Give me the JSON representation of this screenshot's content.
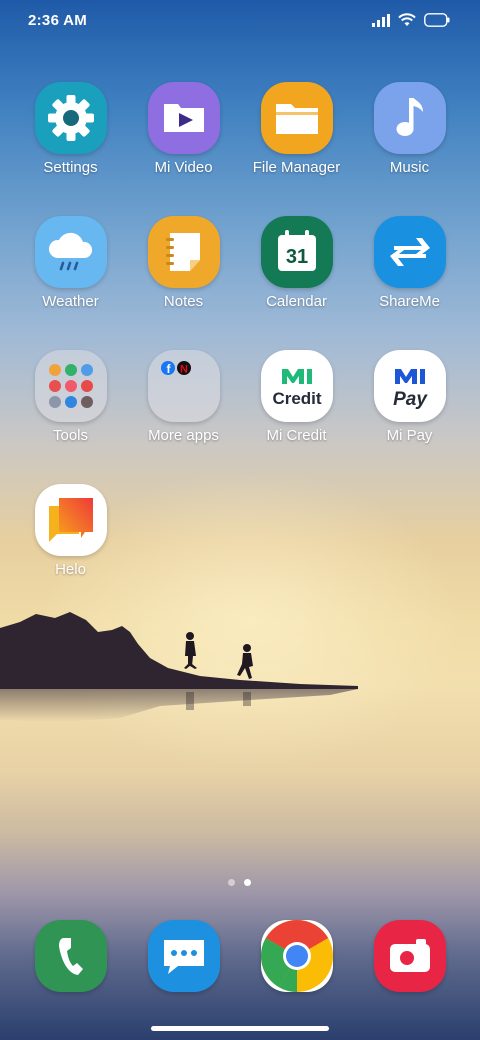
{
  "status_bar": {
    "time": "2:36 AM",
    "icons": [
      "signal-icon",
      "wifi-icon",
      "battery-icon"
    ]
  },
  "apps": [
    {
      "label": "Settings",
      "icon": "gear-icon"
    },
    {
      "label": "Mi Video",
      "icon": "mi-video-icon"
    },
    {
      "label": "File Manager",
      "icon": "folder-icon"
    },
    {
      "label": "Music",
      "icon": "music-note-icon"
    },
    {
      "label": "Weather",
      "icon": "rain-cloud-icon"
    },
    {
      "label": "Notes",
      "icon": "notes-icon"
    },
    {
      "label": "Calendar",
      "icon": "calendar-icon",
      "badge": "31"
    },
    {
      "label": "ShareMe",
      "icon": "transfer-arrows-icon"
    },
    {
      "label": "Tools",
      "icon": "folder-tools-icon"
    },
    {
      "label": "More apps",
      "icon": "folder-more-apps-icon"
    },
    {
      "label": "Mi Credit",
      "icon": "mi-credit-icon",
      "icon_text": "Credit"
    },
    {
      "label": "Mi Pay",
      "icon": "mi-pay-icon",
      "icon_text": "Pay"
    },
    {
      "label": "Helo",
      "icon": "helo-icon"
    }
  ],
  "dock": [
    {
      "icon": "phone-icon"
    },
    {
      "icon": "messages-icon"
    },
    {
      "icon": "chrome-icon"
    },
    {
      "icon": "camera-icon"
    }
  ],
  "page_indicator": {
    "pages": 2,
    "current": 2
  },
  "colors": {
    "settings": "#1aa0bc",
    "mi_video": "#8e6ee0",
    "file_manager": "#f2a51f",
    "music": "#7aa3ec",
    "weather": "#67b7f0",
    "notes": "#f0a82a",
    "calendar": "#147a55",
    "shareme": "#1990e0",
    "mi_credit_green": "#1dba7a",
    "mi_pay_blue": "#1d56d6",
    "phone": "#2f9454",
    "messages": "#1e90e0",
    "camera": "#e82545"
  }
}
